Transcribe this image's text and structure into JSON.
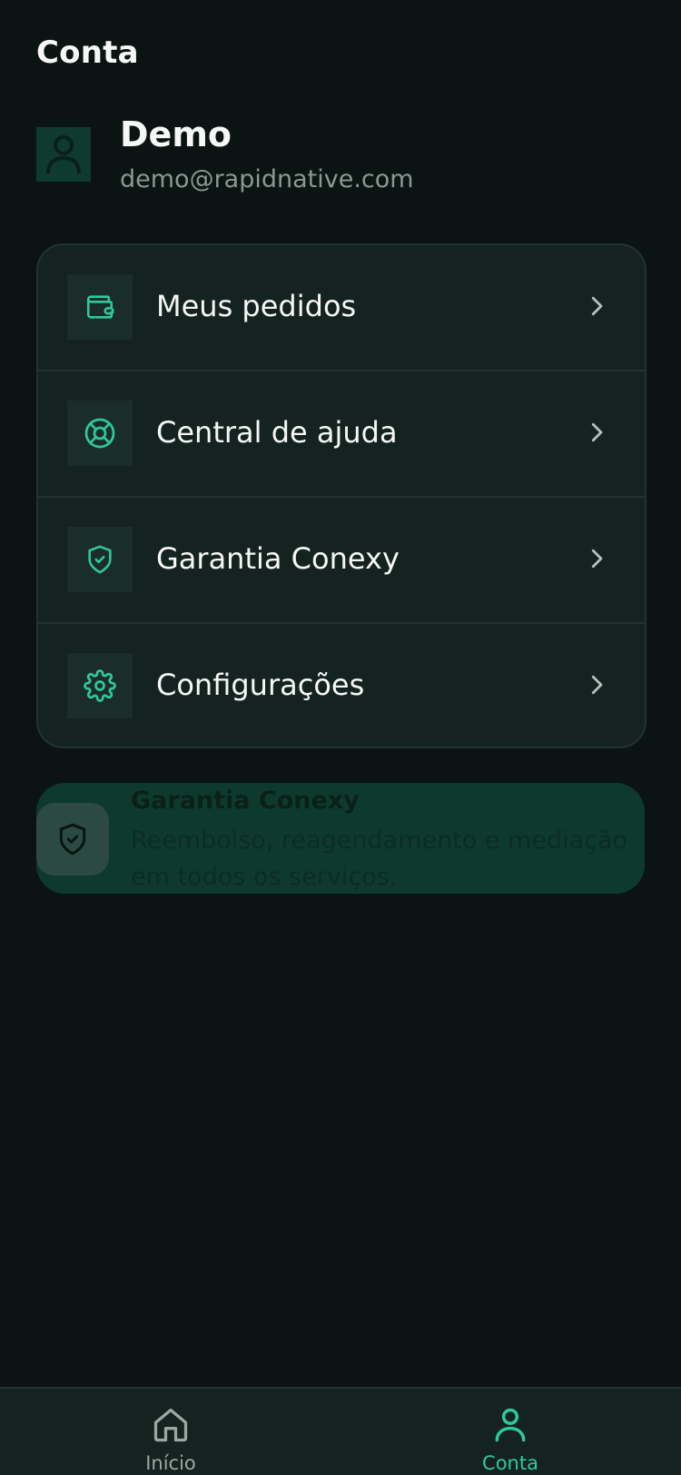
{
  "header": {
    "title": "Conta"
  },
  "profile": {
    "name": "Demo",
    "email": "demo@rapidnative.com"
  },
  "menu": {
    "items": [
      {
        "label": "Meus pedidos",
        "icon": "wallet-icon"
      },
      {
        "label": "Central de ajuda",
        "icon": "lifebuoy-icon"
      },
      {
        "label": "Garantia Conexy",
        "icon": "shield-check-icon"
      },
      {
        "label": "Configurações",
        "icon": "gear-icon"
      }
    ]
  },
  "banner": {
    "title": "Garantia Conexy",
    "text": "Reembolso, reagendamento e mediação em todos os serviços.",
    "icon": "shield-check-icon"
  },
  "tabbar": {
    "tabs": [
      {
        "label": "Início",
        "icon": "home-icon",
        "active": false
      },
      {
        "label": "Conta",
        "icon": "user-icon",
        "active": true
      }
    ]
  },
  "colors": {
    "background": "#0b1412",
    "card": "#152320",
    "accent": "#2ec99a",
    "muted": "#8a9792"
  }
}
